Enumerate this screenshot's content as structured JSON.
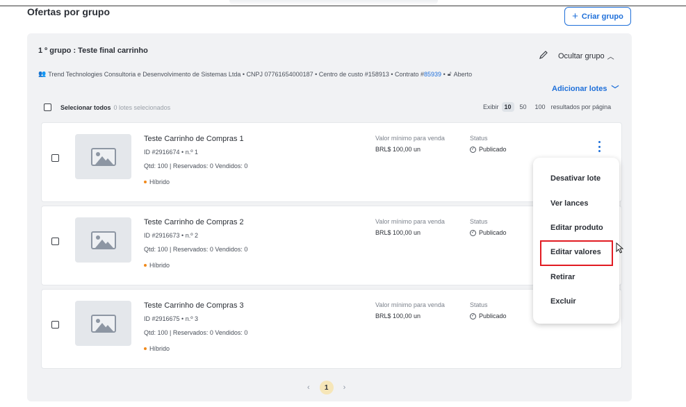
{
  "page": {
    "title": "Ofertas por grupo",
    "create_group_label": "Criar grupo"
  },
  "group": {
    "title": "1 º grupo : Teste final carrinho",
    "hide_label": "Ocultar grupo",
    "info_company": "Trend Technologies Consultoria e Desenvolvimento de Sistemas Ltda",
    "info_cnpj": "CNPJ 07761654000187",
    "info_cost_center": "Centro de custo #158913",
    "info_contract_prefix": "Contrato #",
    "info_contract_number": "85939",
    "info_status": "Aberto",
    "add_lots_label": "Adicionar lotes",
    "select_all_label": "Selecionar todos",
    "selected_count": "0 lotes selecionados",
    "show_label": "Exibir",
    "page_size_options": [
      "10",
      "50",
      "100"
    ],
    "page_size_selected": "10",
    "per_page_suffix": "resultados por página"
  },
  "lots": [
    {
      "name": "Teste Carrinho de Compras 1",
      "id_line": "ID #2916674 • n.º 1",
      "qtd_line": "Qtd: 100 | Reservados: 0 Vendidos: 0",
      "type": "Híbrido",
      "min_label": "Valor mínimo para venda",
      "min_value": "BRL$ 100,00 un",
      "status_label": "Status",
      "status_value": "Publicado"
    },
    {
      "name": "Teste Carrinho de Compras 2",
      "id_line": "ID #2916673 • n.º 2",
      "qtd_line": "Qtd: 100 | Reservados: 0 Vendidos: 0",
      "type": "Híbrido",
      "min_label": "Valor mínimo para venda",
      "min_value": "BRL$ 100,00 un",
      "status_label": "Status",
      "status_value": "Publicado"
    },
    {
      "name": "Teste Carrinho de Compras 3",
      "id_line": "ID #2916675 • n.º 3",
      "qtd_line": "Qtd: 100 | Reservados: 0 Vendidos: 0",
      "type": "Híbrido",
      "min_label": "Valor mínimo para venda",
      "min_value": "BRL$ 100,00 un",
      "status_label": "Status",
      "status_value": "Publicado"
    }
  ],
  "menu": {
    "items": [
      "Desativar lote",
      "Ver lances",
      "Editar produto",
      "Editar valores",
      "Retirar",
      "Excluir"
    ],
    "highlighted": "Editar valores"
  },
  "pagination": {
    "current": "1",
    "prev": "‹",
    "next": "›"
  },
  "colors": {
    "accent": "#1e6fd9",
    "highlight": "#e11b22",
    "hybrid_dot": "#f08a1c",
    "panel_bg": "#f1f2f4"
  }
}
